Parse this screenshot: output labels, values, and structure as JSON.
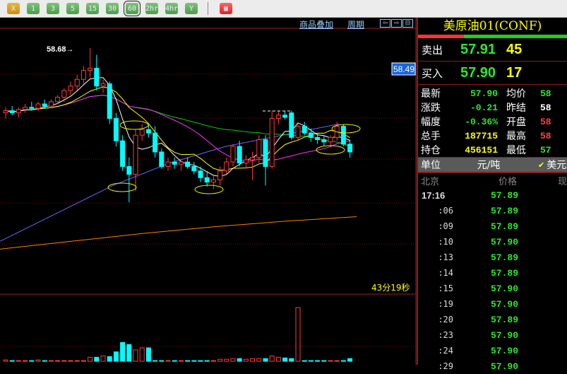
{
  "toolbar": {
    "buttons": [
      "X",
      "1",
      "3",
      "5",
      "15",
      "30",
      "60",
      "2hr",
      "4hr",
      "Y"
    ],
    "selected": "60",
    "extra_icon": "grid-icon"
  },
  "chart_header": {
    "overlay_link": "商品叠加",
    "period_link": "周期"
  },
  "colors": {
    "up": "#ff3b3b",
    "down": "#00ffff",
    "ma5": "#ffffff",
    "ma10": "#ffff00",
    "ma20": "#ff33ff",
    "ma_green": "#00cc00",
    "ma_blue": "#6666ff",
    "ma_orange": "#ff8000"
  },
  "chart_data": {
    "type": "candlestick",
    "high_label": "58.68→",
    "current_price_label": "58.49",
    "countdown": "43分19秒",
    "ylim": [
      56.3,
      58.85
    ],
    "candles": [
      [
        58.1,
        58.15,
        58.05,
        58.12
      ],
      [
        58.12,
        58.16,
        58.08,
        58.1
      ],
      [
        58.1,
        58.15,
        58.06,
        58.13
      ],
      [
        58.13,
        58.18,
        58.1,
        58.15
      ],
      [
        58.15,
        58.2,
        58.12,
        58.14
      ],
      [
        58.14,
        58.2,
        58.12,
        58.18
      ],
      [
        58.18,
        58.22,
        58.14,
        58.16
      ],
      [
        58.16,
        58.22,
        58.14,
        58.2
      ],
      [
        58.2,
        58.26,
        58.18,
        58.24
      ],
      [
        58.24,
        58.32,
        58.2,
        58.3
      ],
      [
        58.3,
        58.38,
        58.26,
        58.34
      ],
      [
        58.34,
        58.44,
        58.3,
        58.4
      ],
      [
        58.4,
        58.52,
        58.36,
        58.48
      ],
      [
        58.48,
        58.68,
        58.42,
        58.5
      ],
      [
        58.5,
        58.62,
        58.3,
        58.34
      ],
      [
        58.34,
        58.4,
        58.28,
        58.36
      ],
      [
        58.36,
        58.38,
        58.0,
        58.05
      ],
      [
        58.05,
        58.1,
        57.8,
        57.85
      ],
      [
        57.85,
        57.9,
        57.58,
        57.62
      ],
      [
        57.62,
        57.7,
        57.3,
        57.55
      ],
      [
        57.55,
        57.95,
        57.4,
        57.9
      ],
      [
        57.9,
        58.0,
        57.85,
        57.95
      ],
      [
        57.95,
        58.0,
        57.88,
        57.92
      ],
      [
        57.92,
        57.98,
        57.7,
        57.75
      ],
      [
        57.75,
        57.78,
        57.6,
        57.62
      ],
      [
        57.62,
        57.7,
        57.58,
        57.66
      ],
      [
        57.66,
        57.7,
        57.6,
        57.64
      ],
      [
        57.64,
        57.68,
        57.58,
        57.66
      ],
      [
        57.66,
        57.7,
        57.6,
        57.62
      ],
      [
        57.62,
        57.66,
        57.55,
        57.58
      ],
      [
        57.58,
        57.62,
        57.48,
        57.52
      ],
      [
        57.52,
        57.58,
        57.44,
        57.48
      ],
      [
        57.48,
        57.55,
        57.42,
        57.5
      ],
      [
        57.5,
        57.62,
        57.45,
        57.58
      ],
      [
        57.58,
        57.7,
        57.55,
        57.66
      ],
      [
        57.66,
        57.82,
        57.62,
        57.8
      ],
      [
        57.8,
        57.85,
        57.62,
        57.65
      ],
      [
        57.65,
        57.72,
        57.6,
        57.68
      ],
      [
        57.68,
        57.75,
        57.5,
        57.7
      ],
      [
        57.7,
        57.9,
        57.65,
        57.86
      ],
      [
        57.86,
        57.9,
        57.45,
        57.62
      ],
      [
        57.62,
        58.12,
        57.6,
        58.05
      ],
      [
        58.05,
        58.12,
        58.0,
        58.08
      ],
      [
        58.08,
        58.12,
        58.04,
        58.06
      ],
      [
        58.1,
        58.12,
        57.86,
        57.88
      ],
      [
        57.88,
        58.0,
        57.86,
        57.98
      ],
      [
        57.98,
        58.02,
        57.9,
        57.92
      ],
      [
        57.92,
        57.96,
        57.84,
        57.88
      ],
      [
        57.88,
        57.92,
        57.82,
        57.86
      ],
      [
        57.86,
        57.9,
        57.8,
        57.84
      ],
      [
        57.84,
        57.9,
        57.8,
        57.88
      ],
      [
        57.88,
        58.02,
        57.85,
        57.98
      ],
      [
        57.98,
        58.0,
        57.8,
        57.82
      ],
      [
        57.82,
        57.86,
        57.7,
        57.75
      ]
    ],
    "volume": [
      2,
      1,
      1,
      1,
      1,
      2,
      1,
      1,
      1,
      1,
      1,
      1,
      1,
      6,
      6,
      8,
      7,
      14,
      28,
      25,
      17,
      20,
      20,
      1,
      1,
      1,
      1,
      1,
      1,
      1,
      1,
      1,
      1,
      3,
      3,
      4,
      4,
      3,
      4,
      4,
      4,
      8,
      6,
      5,
      4,
      80,
      1,
      1,
      1,
      1,
      1,
      1,
      1,
      4,
      2
    ],
    "ma_blue": [
      56.95,
      57.2,
      57.45,
      57.65,
      57.8,
      57.9,
      58.0
    ],
    "ma_orange": [
      56.88,
      56.95,
      57.02,
      57.08,
      57.13,
      57.17
    ]
  },
  "quote": {
    "name": "美原油01(CONF)",
    "ask_label": "卖出",
    "ask_price": "57.91",
    "ask_vol": "45",
    "bid_label": "买入",
    "bid_price": "57.90",
    "bid_vol": "17",
    "stats": [
      {
        "k": "最新",
        "v": "57.90",
        "vc": "#2ee62e",
        "k2": "均价",
        "v2": "58",
        "v2c": "#2ee62e"
      },
      {
        "k": "涨跌",
        "v": "-0.21",
        "vc": "#2ee62e",
        "k2": "昨结",
        "v2": "58",
        "v2c": "#ffffff"
      },
      {
        "k": "幅度",
        "v": "-0.36%",
        "vc": "#2ee62e",
        "k2": "开盘",
        "v2": "58",
        "v2c": "#ff4040"
      },
      {
        "k": "总手",
        "v": "187715",
        "vc": "#ffff00",
        "k2": "最高",
        "v2": "58",
        "v2c": "#ff4040"
      },
      {
        "k": "持仓",
        "v": "456151",
        "vc": "#ffff00",
        "k2": "最低",
        "v2": "57",
        "v2c": "#2ee62e"
      }
    ],
    "unit_label": "单位",
    "unit_value": "元/吨",
    "currency": "美元",
    "ticks_header": {
      "time": "北京",
      "price": "价格",
      "vol": "现"
    },
    "ticks": [
      {
        "t": "17:16",
        "p": "57.89"
      },
      {
        "t": ":06",
        "p": "57.89"
      },
      {
        "t": ":09",
        "p": "57.89"
      },
      {
        "t": ":10",
        "p": "57.90"
      },
      {
        "t": ":13",
        "p": "57.89"
      },
      {
        "t": ":14",
        "p": "57.89"
      },
      {
        "t": ":15",
        "p": "57.90"
      },
      {
        "t": ":19",
        "p": "57.90"
      },
      {
        "t": ":20",
        "p": "57.89"
      },
      {
        "t": ":23",
        "p": "57.90"
      },
      {
        "t": ":24",
        "p": "57.90"
      },
      {
        "t": ":29",
        "p": "57.90"
      }
    ]
  }
}
